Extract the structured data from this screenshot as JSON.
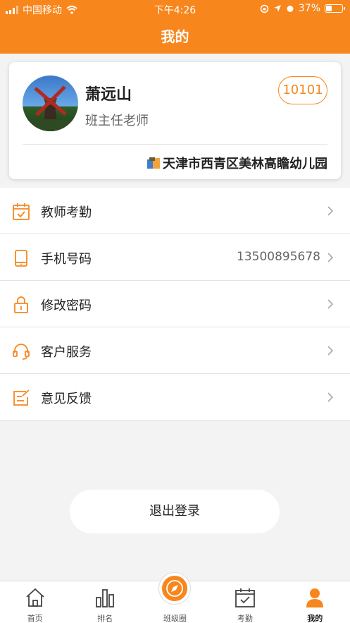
{
  "status": {
    "carrier": "中国移动",
    "time": "下午4:26",
    "battery": "37%",
    "battery_level": 0.37
  },
  "header": {
    "title": "我的"
  },
  "profile": {
    "name": "萧远山",
    "role": "班主任老师",
    "badge": "10101",
    "school": "天津市西青区美林高瞻幼儿园"
  },
  "menu": [
    {
      "label": "教师考勤",
      "value": "",
      "icon": "calendar-check-icon"
    },
    {
      "label": "手机号码",
      "value": "13500895678",
      "icon": "phone-icon"
    },
    {
      "label": "修改密码",
      "value": "",
      "icon": "lock-icon"
    },
    {
      "label": "客户服务",
      "value": "",
      "icon": "headset-icon"
    },
    {
      "label": "意见反馈",
      "value": "",
      "icon": "feedback-icon"
    }
  ],
  "logout": {
    "label": "退出登录"
  },
  "tabs": [
    {
      "label": "首页",
      "icon": "home-icon"
    },
    {
      "label": "排名",
      "icon": "ranking-icon"
    },
    {
      "label": "班级圈",
      "icon": "compass-icon"
    },
    {
      "label": "考勤",
      "icon": "attendance-icon"
    },
    {
      "label": "我的",
      "icon": "user-icon"
    }
  ],
  "colors": {
    "accent": "#f7861c",
    "background": "#f3f3f3"
  }
}
